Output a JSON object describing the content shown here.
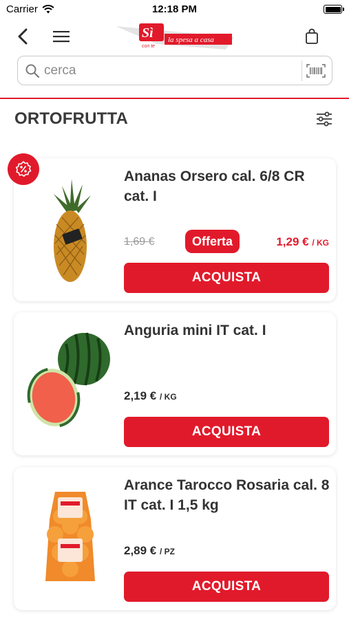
{
  "status": {
    "carrier": "Carrier",
    "time": "12:18 PM"
  },
  "header": {
    "logo_main": "Sì",
    "logo_sub": "con te",
    "logo_tagline": "la spesa a casa"
  },
  "search": {
    "placeholder": "cerca"
  },
  "section": {
    "title": "ORTOFRUTTA"
  },
  "products": [
    {
      "name": "Ananas Orsero cal. 6/8 CR cat. I",
      "old_price": "1,69 €",
      "badge": "Offerta",
      "price": "1,29 €",
      "unit": "/ KG",
      "button": "ACQUISTA"
    },
    {
      "name": "Anguria mini IT cat. I",
      "price": "2,19 €",
      "unit": "/ KG",
      "button": "ACQUISTA"
    },
    {
      "name": "Arance Tarocco Rosaria cal. 8 IT cat. I 1,5 kg",
      "price": "2,89 €",
      "unit": "/ PZ",
      "button": "ACQUISTA"
    }
  ],
  "colors": {
    "accent": "#e11a2b",
    "text": "#2b2b2b",
    "muted": "#9a9a9a"
  },
  "icons": [
    "back-arrow-icon",
    "hamburger-menu-icon",
    "shopping-bag-icon",
    "search-icon",
    "barcode-icon",
    "filter-sliders-icon",
    "discount-percent-icon"
  ]
}
